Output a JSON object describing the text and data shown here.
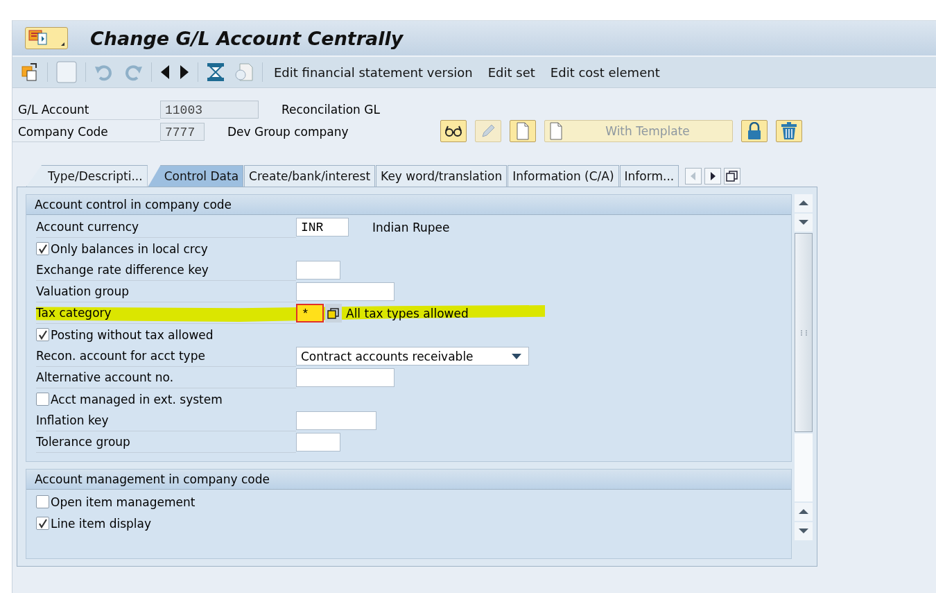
{
  "window": {
    "title": "Change G/L Account Centrally"
  },
  "toolbar": {
    "buttons": [
      "Edit financial statement version",
      "Edit set",
      "Edit cost element"
    ]
  },
  "header": {
    "fields": [
      {
        "label": "G/L Account",
        "value": "11003",
        "description": "Reconcilation GL"
      },
      {
        "label": "Company Code",
        "value": "7777",
        "description": "Dev Group company"
      }
    ],
    "template_button": "With Template"
  },
  "tabs": [
    {
      "label": "Type/Descripti...",
      "selected": false
    },
    {
      "label": "Control Data",
      "selected": true
    },
    {
      "label": "Create/bank/interest",
      "selected": false
    },
    {
      "label": "Key word/translation",
      "selected": false
    },
    {
      "label": "Information (C/A)",
      "selected": false
    },
    {
      "label": "Inform...",
      "selected": false
    }
  ],
  "sections": [
    {
      "title": "Account control in company code",
      "rows": [
        {
          "kind": "field",
          "label": "Account currency",
          "value": "INR",
          "description": "Indian Rupee",
          "focused": false,
          "highlighted": false
        },
        {
          "kind": "checkbox",
          "label": "Only balances in local crcy",
          "checked": true
        },
        {
          "kind": "field",
          "label": "Exchange rate difference key",
          "value": "",
          "focused": false,
          "highlighted": false
        },
        {
          "kind": "field",
          "label": "Valuation group",
          "value": "",
          "focused": false,
          "highlighted": false
        },
        {
          "kind": "field",
          "label": "Tax category",
          "value": "*",
          "description": "All tax types allowed",
          "focused": true,
          "highlighted": true
        },
        {
          "kind": "checkbox",
          "label": "Posting without tax allowed",
          "checked": true
        },
        {
          "kind": "dropdown",
          "label": "Recon. account for acct type",
          "value": "Contract accounts receivable"
        },
        {
          "kind": "field",
          "label": "Alternative account no.",
          "value": "",
          "focused": false,
          "highlighted": false
        },
        {
          "kind": "checkbox",
          "label": "Acct managed in ext. system",
          "checked": false
        },
        {
          "kind": "field",
          "label": "Inflation key",
          "value": "",
          "focused": false,
          "highlighted": false
        },
        {
          "kind": "field",
          "label": "Tolerance group",
          "value": "",
          "focused": false,
          "highlighted": false
        }
      ]
    },
    {
      "title": "Account management in company code",
      "rows": [
        {
          "kind": "checkbox",
          "label": "Open item management",
          "checked": false
        },
        {
          "kind": "checkbox",
          "label": "Line item display",
          "checked": true
        }
      ]
    }
  ]
}
